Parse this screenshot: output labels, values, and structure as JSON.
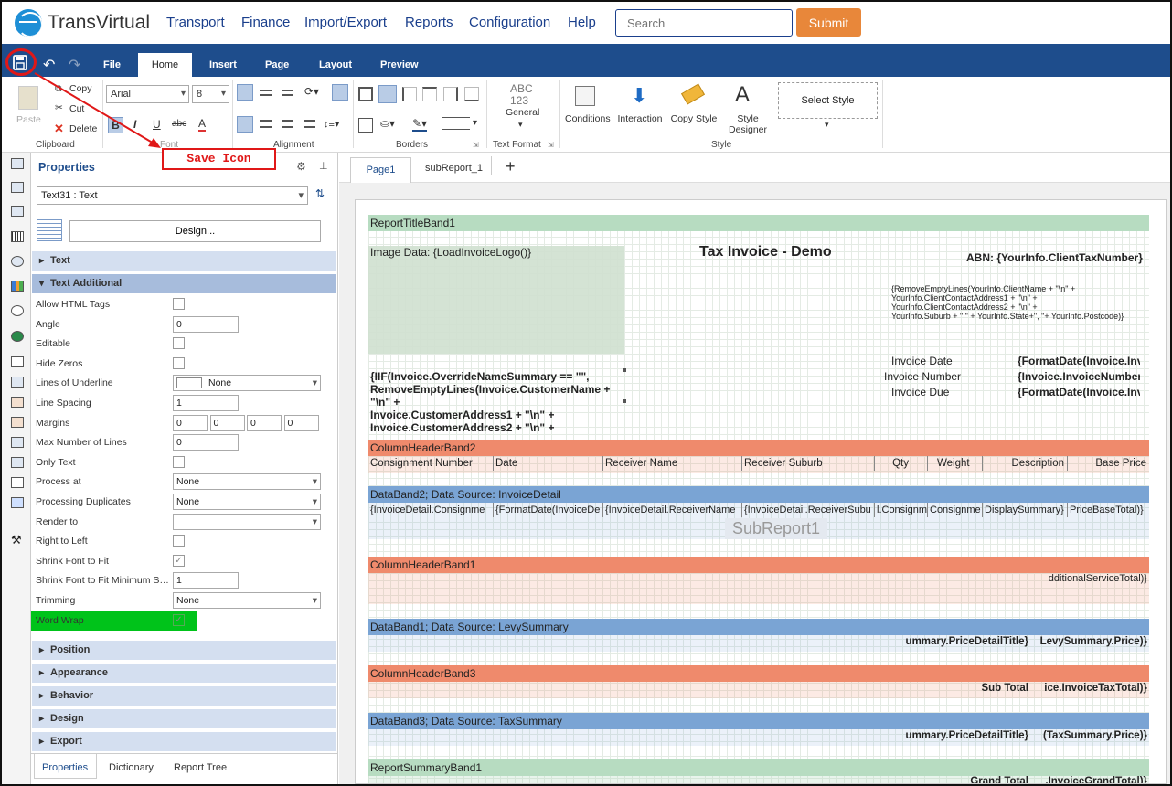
{
  "app": {
    "logo_text": "TransVirtual"
  },
  "nav": {
    "items": [
      "Transport",
      "Finance",
      "Import/Export",
      "Reports",
      "Configuration",
      "Help"
    ]
  },
  "search": {
    "placeholder": "Search"
  },
  "submit_label": "Submit",
  "ribbon_tabs": [
    "File",
    "Home",
    "Insert",
    "Page",
    "Layout",
    "Preview"
  ],
  "ribbon": {
    "clipboard": {
      "paste": "Paste",
      "copy": "Copy",
      "cut": "Cut",
      "delete": "Delete",
      "label": "Clipboard"
    },
    "font": {
      "family": "Arial",
      "size": "8",
      "label": "Font"
    },
    "alignment_label": "Alignment",
    "borders_label": "Borders",
    "text_format": {
      "abc": "ABC",
      "num": "123",
      "general": "General",
      "label": "Text Format"
    },
    "style": {
      "conditions": "Conditions",
      "interaction": "Interaction",
      "copy_style": "Copy Style",
      "style_designer_1": "Style",
      "style_designer_2": "Designer",
      "select_style": "Select Style",
      "label": "Style"
    }
  },
  "annotation": {
    "callout": "Save Icon"
  },
  "properties": {
    "title": "Properties",
    "selected": "Text31 : Text",
    "design_button": "Design...",
    "sections": {
      "text": "Text",
      "text_additional": "Text Additional",
      "position": "Position",
      "appearance": "Appearance",
      "behavior": "Behavior",
      "design": "Design",
      "export": "Export"
    },
    "rows": [
      {
        "label": "Allow HTML Tags",
        "type": "check",
        "value": ""
      },
      {
        "label": "Angle",
        "type": "input",
        "value": "0"
      },
      {
        "label": "Editable",
        "type": "check",
        "value": ""
      },
      {
        "label": "Hide Zeros",
        "type": "check",
        "value": ""
      },
      {
        "label": "Lines of Underline",
        "type": "select",
        "value": "None"
      },
      {
        "label": "Line Spacing",
        "type": "input",
        "value": "1"
      },
      {
        "label": "Margins",
        "type": "margins",
        "value": "0"
      },
      {
        "label": "Max Number of Lines",
        "type": "input",
        "value": "0"
      },
      {
        "label": "Only Text",
        "type": "check",
        "value": ""
      },
      {
        "label": "Process at",
        "type": "select",
        "value": "None"
      },
      {
        "label": "Processing Duplicates",
        "type": "select",
        "value": "None"
      },
      {
        "label": "Render to",
        "type": "select",
        "value": ""
      },
      {
        "label": "Right to Left",
        "type": "check",
        "value": ""
      },
      {
        "label": "Shrink Font to Fit",
        "type": "check",
        "value": "✓"
      },
      {
        "label": "Shrink Font to Fit Minimum Size",
        "type": "input",
        "value": "1"
      },
      {
        "label": "Trimming",
        "type": "select",
        "value": "None"
      },
      {
        "label": "Word Wrap",
        "type": "check",
        "value": "✓"
      }
    ],
    "bottom_tabs": [
      "Properties",
      "Dictionary",
      "Report Tree"
    ]
  },
  "page_tabs": {
    "page1": "Page1",
    "subreport": "subReport_1",
    "add": "+"
  },
  "report": {
    "title_band": "ReportTitleBand1",
    "image_data": "Image Data: {LoadInvoiceLogo()}",
    "invoice_title": "Tax Invoice - Demo",
    "abn": "ABN: {YourInfo.ClientTaxNumber}",
    "address_lines": [
      "{RemoveEmptyLines(YourInfo.ClientName + \"\\n\" +",
      "YourInfo.ClientContactAddress1 + \"\\n\" +",
      "YourInfo.ClientContactAddress2 + \"\\n\" +",
      "YourInfo.Suburb + \" \" + YourInfo.State+\", \"+ YourInfo.Postcode)}"
    ],
    "customer_lines": [
      "{IIF(Invoice.OverrideNameSummary == \"\",",
      "RemoveEmptyLines(Invoice.CustomerName +",
      "\"\\n\" +",
      "Invoice.CustomerAddress1 + \"\\n\" +",
      "Invoice.CustomerAddress2 + \"\\n\" +"
    ],
    "invoice_labels": [
      "Invoice Date",
      "Invoice Number",
      "Invoice Due"
    ],
    "invoice_values": [
      "{FormatDate(Invoice.Inv",
      "{Invoice.InvoiceNumber",
      "{FormatDate(Invoice.Inv"
    ],
    "column_header_band2": "ColumnHeaderBand2",
    "columns": [
      "Consignment Number",
      "Date",
      "Receiver Name",
      "Receiver Suburb",
      "Qty",
      "Weight",
      "Description",
      "Base Price"
    ],
    "data_band2": "DataBand2; Data Source: InvoiceDetail",
    "data_fields": [
      "{InvoiceDetail.Consignme",
      "{FormatDate(InvoiceDe",
      "{InvoiceDetail.ReceiverName",
      "{InvoiceDetail.ReceiverSubu",
      "l.Consignm",
      "Consignme",
      "DisplaySummary}",
      "PriceBaseTotal)}"
    ],
    "subreport": "SubReport1",
    "column_header_band1": "ColumnHeaderBand1",
    "additional_service": "dditionalServiceTotal)}",
    "data_band1": "DataBand1; Data Source: LevySummary",
    "levy_title": "ummary.PriceDetailTitle}",
    "levy_price": "LevySummary.Price)}",
    "column_header_band3": "ColumnHeaderBand3",
    "sub_total_label": "Sub Total",
    "sub_total_value": "ice.InvoiceTaxTotal)}",
    "data_band3": "DataBand3; Data Source: TaxSummary",
    "tax_title": "ummary.PriceDetailTitle}",
    "tax_price": "(TaxSummary.Price)}",
    "summary_band": "ReportSummaryBand1",
    "grand_total_label": "Grand Total",
    "grand_total_value": ".InvoiceGrandTotal)}"
  },
  "colors": {
    "nav_blue": "#1e4d8c",
    "accent_orange": "#e8873a",
    "annotation_red": "#e01818",
    "title_band": "#b7dcc1",
    "header_band": "#ef8a6c",
    "data_band": "#7aa4d4",
    "word_wrap_highlight": "#00c31a"
  }
}
